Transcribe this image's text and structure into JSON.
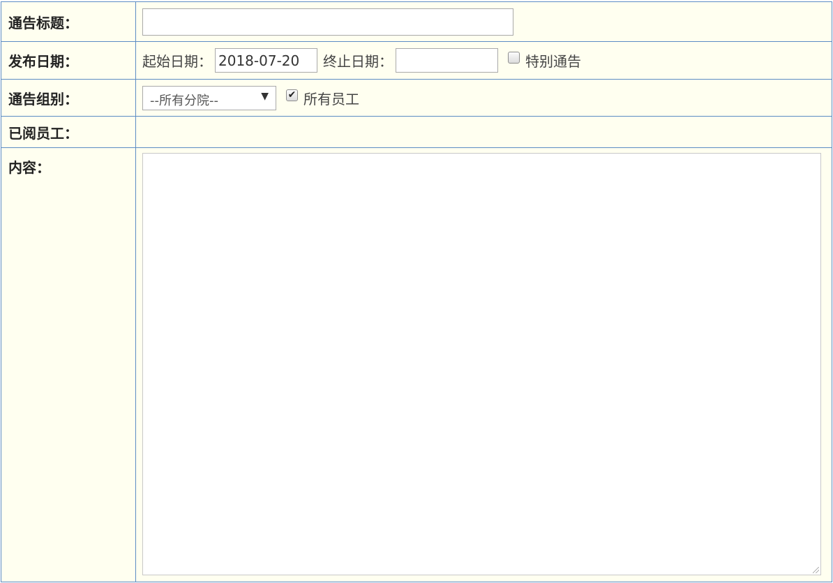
{
  "form": {
    "title_row": {
      "label": "通告标题：",
      "value": ""
    },
    "date_row": {
      "label": "发布日期：",
      "start_label": "起始日期：",
      "start_value": "2018-07-20",
      "end_label": "终止日期：",
      "end_value": "",
      "special_notice_label": "特别通告",
      "special_notice_checked": false
    },
    "group_row": {
      "label": "通告组别：",
      "selected_option": "--所有分院--",
      "all_staff_label": "所有员工",
      "all_staff_checked": true
    },
    "read_row": {
      "label": "已阅员工："
    },
    "content_row": {
      "label": "内容：",
      "value": ""
    }
  },
  "icons": {
    "dropdown": "chevron-down-icon",
    "check": "checkmark-icon",
    "resize": "resize-grip-icon"
  },
  "colors": {
    "cell_background": "#fffff0",
    "border": "#5b8cc4"
  }
}
